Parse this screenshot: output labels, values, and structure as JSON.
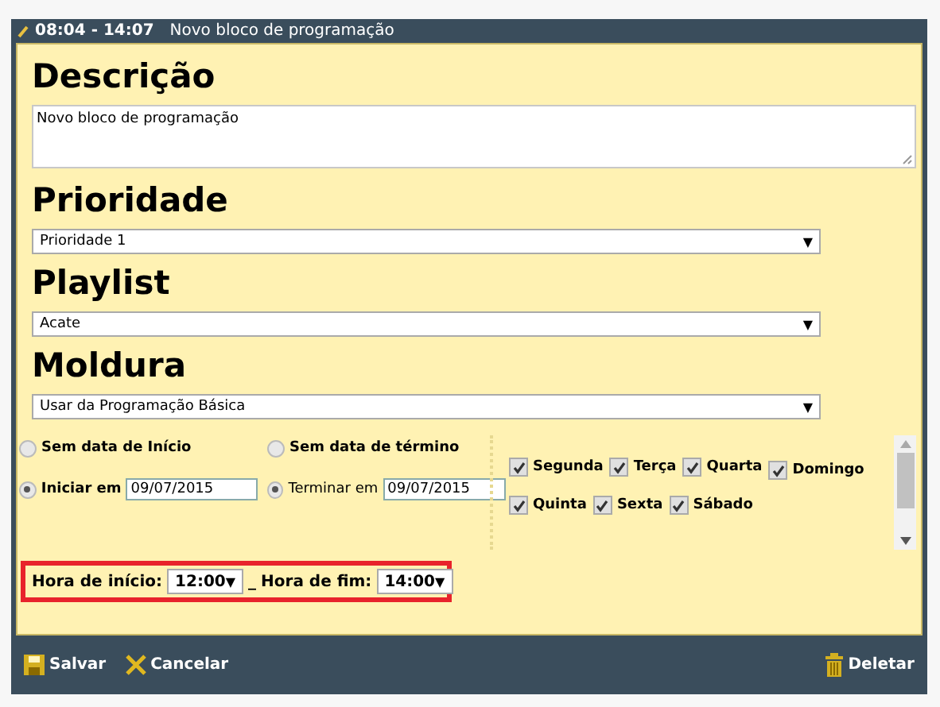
{
  "window": {
    "time_range": "08:04 - 14:07",
    "title": "Novo bloco de programação"
  },
  "sections": [
    {
      "heading": "Descrição",
      "kind": "textarea",
      "value": "Novo bloco de programação"
    },
    {
      "heading": "Prioridade",
      "kind": "select",
      "value": "Prioridade 1"
    },
    {
      "heading": "Playlist",
      "kind": "select",
      "value": "Acate"
    },
    {
      "heading": "Moldura",
      "kind": "select",
      "value": "Usar da Programação Básica"
    }
  ],
  "start_options": [
    {
      "label": "Sem data de Início",
      "selected": false
    },
    {
      "label": "Iniciar em",
      "selected": true,
      "date": "09/07/2015"
    }
  ],
  "end_options": [
    {
      "label": "Sem data de término",
      "selected": false
    },
    {
      "label": "Terminar em",
      "selected": true,
      "date": "09/07/2015"
    }
  ],
  "days": [
    {
      "label": "Segunda",
      "checked": true
    },
    {
      "label": "Terça",
      "checked": true
    },
    {
      "label": "Quarta",
      "checked": true
    },
    {
      "label": "Domingo",
      "checked": true
    },
    {
      "label": "Quinta",
      "checked": true
    },
    {
      "label": "Sexta",
      "checked": true
    },
    {
      "label": "Sábado",
      "checked": true
    }
  ],
  "hours": {
    "start_label": "Hora de início:",
    "start": "12:00",
    "separator": "_",
    "end_label": "Hora de fim:",
    "end": "14:00",
    "arrow": "▼"
  },
  "footer": {
    "save": "Salvar",
    "cancel": "Cancelar",
    "delete": "Deletar"
  }
}
